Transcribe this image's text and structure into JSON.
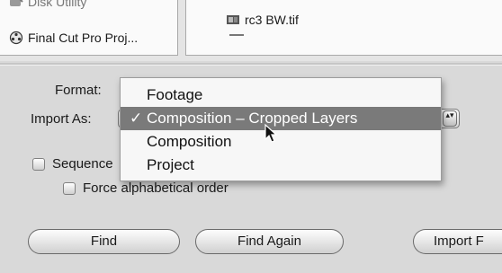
{
  "browser": {
    "left_items": [
      {
        "label": "Disk Utility",
        "icon": "disk-utility-icon"
      },
      {
        "label": "Final Cut Pro Proj...",
        "icon": "final-cut-pro-icon"
      }
    ],
    "right_items": [
      {
        "label": "rc3 BW.tif",
        "icon": "tif-file-icon"
      }
    ]
  },
  "options": {
    "format_label": "Format:",
    "import_as_label": "Import As:"
  },
  "menu": {
    "items": [
      {
        "label": "Footage",
        "selected": false
      },
      {
        "label": "Composition – Cropped Layers",
        "selected": true,
        "checked": true
      },
      {
        "label": "Composition",
        "selected": false
      },
      {
        "label": "Project",
        "selected": false
      }
    ],
    "check_glyph": "✓",
    "stepper_glyph": "▴▾"
  },
  "checkboxes": {
    "sequence_label": "Sequence",
    "force_alpha_label": "Force alphabetical order"
  },
  "buttons": {
    "find": "Find",
    "find_again": "Find Again",
    "import": "Import F"
  },
  "colors": {
    "menu_highlight": "#7a7a7a",
    "background": "#d9d9d9"
  }
}
